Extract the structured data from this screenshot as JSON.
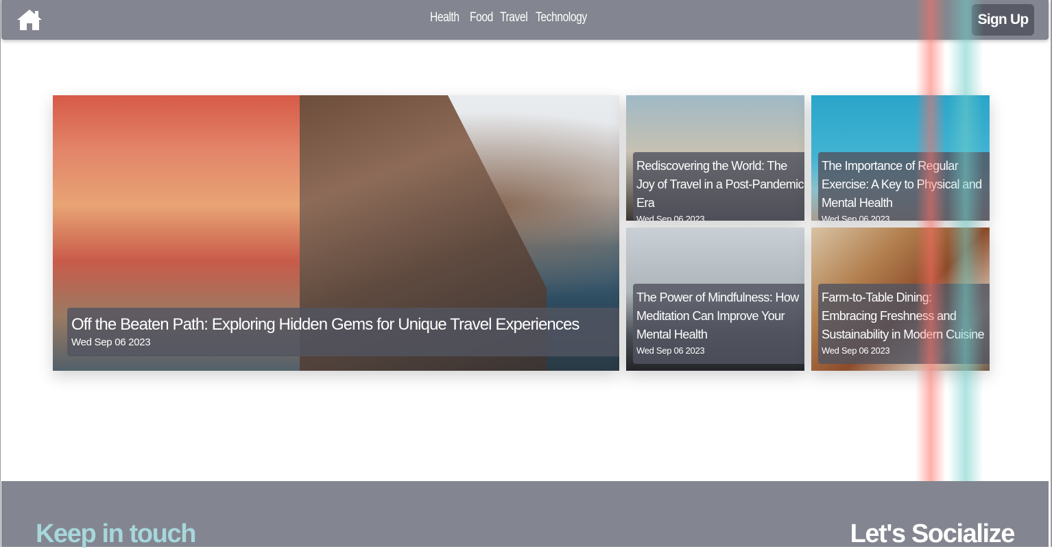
{
  "header": {
    "nav": [
      "Health",
      "Food",
      "Travel",
      "Technology"
    ],
    "signup_label": "Sign Up"
  },
  "featured": {
    "title": "Off the Beaten Path: Exploring Hidden Gems for Unique Travel Experiences",
    "date": "Wed Sep 06 2023"
  },
  "posts": [
    {
      "title": "Rediscovering the World: The Joy of Travel in a Post-Pandemic Era",
      "date": "Wed Sep 06 2023"
    },
    {
      "title": "The Importance of Regular Exercise: A Key to Physical and Mental Health",
      "date": "Wed Sep 06 2023"
    },
    {
      "title": "The Power of Mindfulness: How Meditation Can Improve Your Mental Health",
      "date": "Wed Sep 06 2023"
    },
    {
      "title": "Farm-to-Table Dining: Embracing Freshness and Sustainability in Modern Cuisine",
      "date": "Wed Sep 06 2023"
    }
  ],
  "footer": {
    "left_heading": "Keep in touch",
    "right_heading": "Let's Socialize"
  },
  "colors": {
    "navbar": "#838690",
    "signup": "#585b66",
    "footer_accent": "#a7d7dc"
  },
  "icons": {
    "home": "home-icon"
  }
}
